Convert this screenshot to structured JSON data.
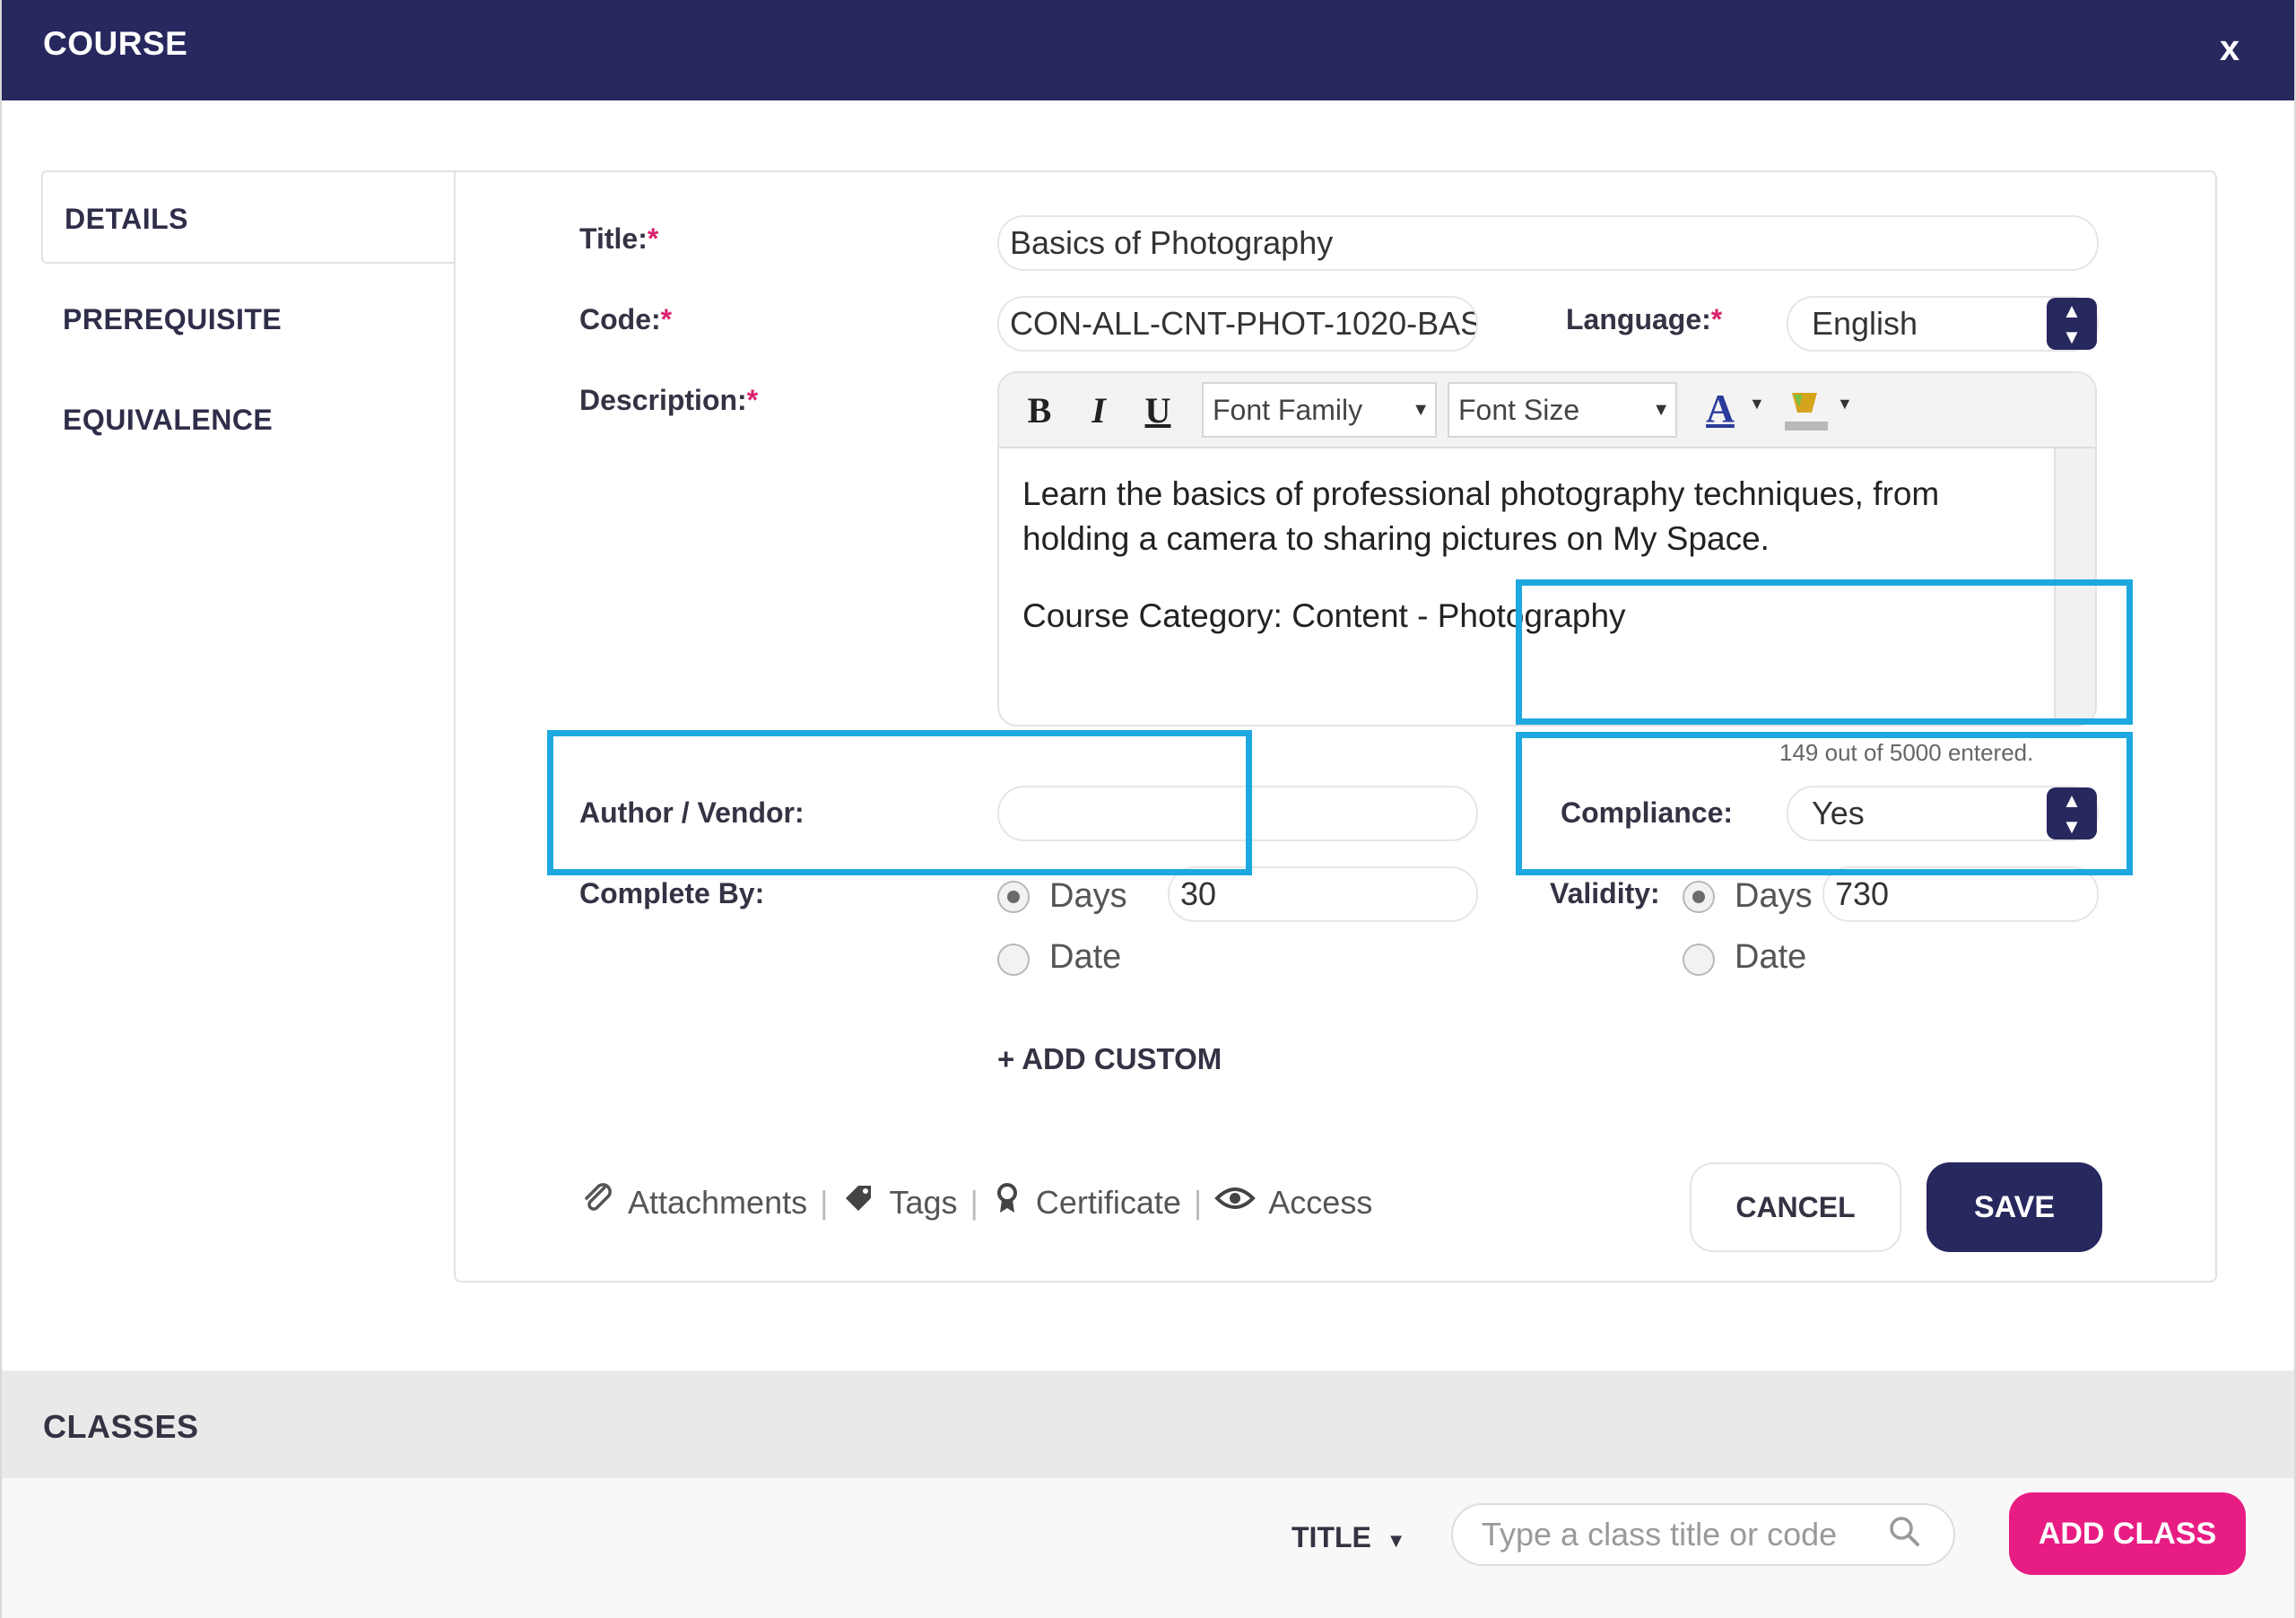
{
  "dialog": {
    "title": "COURSE",
    "close_label": "x"
  },
  "side_tabs": [
    {
      "label": "DETAILS",
      "active": true
    },
    {
      "label": "PREREQUISITE",
      "active": false
    },
    {
      "label": "EQUIVALENCE",
      "active": false
    }
  ],
  "form": {
    "title_label": "Title:",
    "title_value": "Basics of Photography",
    "code_label": "Code:",
    "code_value": "CON-ALL-CNT-PHOT-1020-BAS",
    "language_label": "Language:",
    "language_value": "English",
    "description_label": "Description:",
    "required_mark": "*",
    "editor": {
      "bold": "B",
      "italic": "I",
      "underline": "U",
      "font_family_placeholder": "Font Family",
      "font_size_placeholder": "Font Size",
      "text_color_glyph": "A",
      "content_line1": "Learn the basics of professional photography techniques, from holding a camera to sharing pictures on My Space.",
      "content_line2": "Course Category: Content - Photography"
    },
    "char_count": "149 out of 5000 entered.",
    "author_label": "Author / Vendor:",
    "author_value": "",
    "compliance_label": "Compliance:",
    "compliance_value": "Yes",
    "complete_by_label": "Complete By:",
    "complete_by_days_label": "Days",
    "complete_by_days_value": "30",
    "complete_by_date_label": "Date",
    "validity_label": "Validity:",
    "validity_days_label": "Days",
    "validity_days_value": "730",
    "validity_date_label": "Date",
    "add_custom_label": "+ ADD CUSTOM"
  },
  "footer_links": {
    "attachments": "Attachments",
    "tags": "Tags",
    "certificate": "Certificate",
    "access": "Access",
    "separator": "|"
  },
  "actions": {
    "cancel": "CANCEL",
    "save": "SAVE"
  },
  "classes": {
    "title": "CLASSES",
    "sort_label": "TITLE",
    "search_placeholder": "Type a class title or code",
    "add_button": "ADD CLASS"
  },
  "colors": {
    "header_bg": "#27285e",
    "highlight": "#1da8e0",
    "add_class_bg": "#e81d84",
    "required": "#d9226f"
  }
}
